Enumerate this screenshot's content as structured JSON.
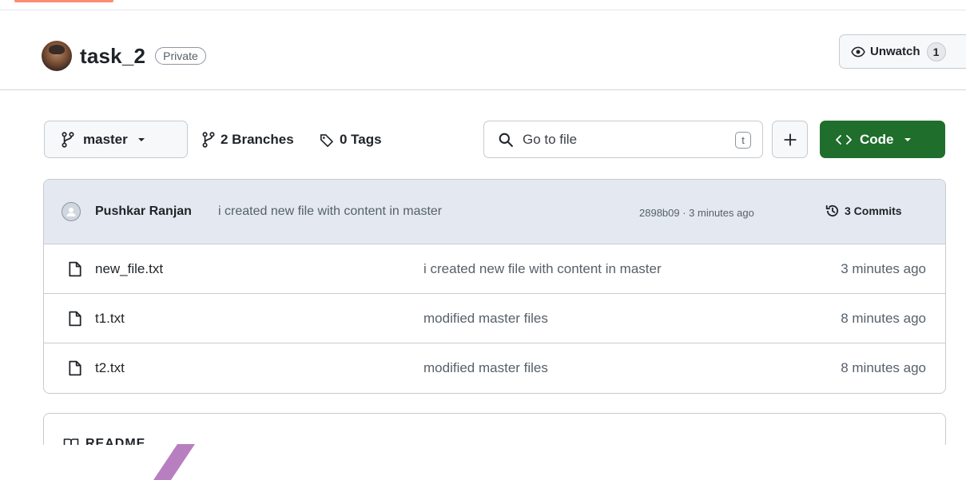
{
  "repo": {
    "name": "task_2",
    "visibility": "Private"
  },
  "watch": {
    "label": "Unwatch",
    "count": "1"
  },
  "toolbar": {
    "branch": "master",
    "branches": "2 Branches",
    "tags": "0 Tags",
    "search_placeholder": "Go to file",
    "search_shortcut": "t",
    "code_label": "Code"
  },
  "latest_commit": {
    "author": "Pushkar Ranjan",
    "message": "i created new file with content in master",
    "meta": "2898b09 · 3 minutes ago",
    "commits_label": "3 Commits"
  },
  "files": [
    {
      "name": "new_file.txt",
      "commit": "i created new file with content in master",
      "time": "3 minutes ago"
    },
    {
      "name": "t1.txt",
      "commit": "modified master files",
      "time": "8 minutes ago"
    },
    {
      "name": "t2.txt",
      "commit": "modified master files",
      "time": "8 minutes ago"
    }
  ],
  "readme": {
    "title": "README"
  },
  "colors": {
    "code_button": "#1f6e2c",
    "commit_bar": "#e4e9f1",
    "tab_underline": "#fd8c73",
    "pen_stroke": "#b87fc0"
  }
}
